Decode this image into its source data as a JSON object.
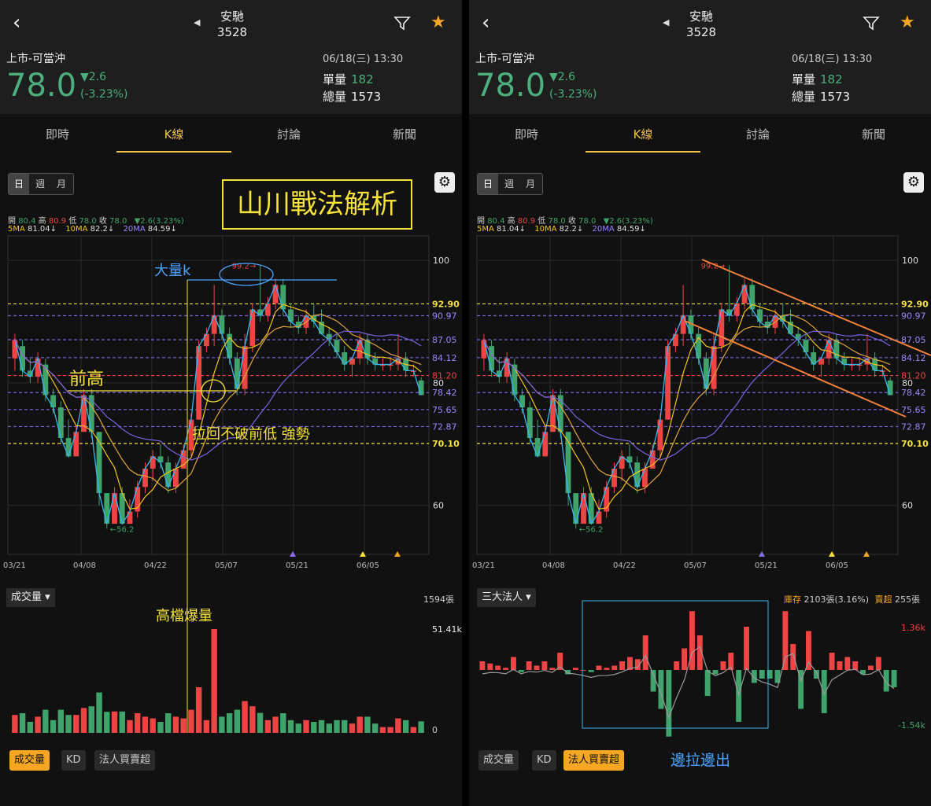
{
  "header": {
    "stock_name": "安馳",
    "stock_code": "3528",
    "market": "上市-可當沖",
    "datetime": "06/18(三) 13:30",
    "price": "78.0",
    "change": "▼2.6",
    "change_pct": "(-3.23%)",
    "vol_label": "單量",
    "vol_value": "182",
    "total_label": "總量",
    "total_value": "1573",
    "back_icon": "chevron-left-icon",
    "prev_icon": "triangle-left-icon",
    "filter_icon": "filter-icon",
    "star_icon": "star-icon"
  },
  "tabs": [
    "即時",
    "K線",
    "討論",
    "新聞"
  ],
  "active_tab": "K線",
  "periods": [
    "日",
    "週",
    "月"
  ],
  "active_period": "日",
  "ohlc_line": {
    "open_label": "開",
    "open": "80.4",
    "high_label": "高",
    "high": "80.9",
    "low_label": "低",
    "low": "78.0",
    "close_label": "收",
    "close": "78.0",
    "change": "▼2.6(3.23%)"
  },
  "ma_line": {
    "ma5": "5MA",
    "ma5_val": "81.04↓",
    "ma10": "10MA",
    "ma10_val": "82.2↓",
    "ma20": "20MA",
    "ma20_val": "84.59↓"
  },
  "colors": {
    "up": "#ef4444",
    "down": "#3fa36b",
    "ma5": "#f5c518",
    "ma10": "#e0a43a",
    "ma20": "#7b63e0",
    "accent": "#f0c24b",
    "annotation": "#f5e23b",
    "price_green": "#4caf7d"
  },
  "price_axis": {
    "ticks": [
      "100",
      "80",
      "60"
    ],
    "lines": [
      "92.90",
      "90.97",
      "87.05",
      "84.12",
      "81.20",
      "78.42",
      "75.65",
      "72.87",
      "70.10"
    ],
    "right_labels_p1": [
      "92.90",
      "90.97",
      "87.05",
      "84.12",
      "81.20",
      "78.42",
      "75.65",
      "72.87",
      "70.10"
    ]
  },
  "chart_marks": {
    "high": "99.2→",
    "low": "←56.2"
  },
  "x_labels": [
    "03/21",
    "04/08",
    "04/22",
    "05/07",
    "05/21",
    "06/05"
  ],
  "chart_data": {
    "type": "candlestick",
    "ylim": [
      52,
      104
    ],
    "candles": [
      {
        "o": 84,
        "h": 88,
        "l": 82,
        "c": 87
      },
      {
        "o": 86,
        "h": 87,
        "l": 81,
        "c": 82
      },
      {
        "o": 82,
        "h": 84,
        "l": 80,
        "c": 81
      },
      {
        "o": 81,
        "h": 85,
        "l": 80,
        "c": 84
      },
      {
        "o": 83,
        "h": 84,
        "l": 77,
        "c": 78
      },
      {
        "o": 78,
        "h": 79,
        "l": 75,
        "c": 76
      },
      {
        "o": 76,
        "h": 77,
        "l": 70,
        "c": 71
      },
      {
        "o": 71,
        "h": 74,
        "l": 68,
        "c": 68
      },
      {
        "o": 68,
        "h": 73,
        "l": 68,
        "c": 72
      },
      {
        "o": 72,
        "h": 79,
        "l": 72,
        "c": 78
      },
      {
        "o": 78,
        "h": 79,
        "l": 71,
        "c": 72
      },
      {
        "o": 72,
        "h": 72,
        "l": 60,
        "c": 62
      },
      {
        "o": 62,
        "h": 62,
        "l": 56.2,
        "c": 57
      },
      {
        "o": 57,
        "h": 63,
        "l": 57,
        "c": 62
      },
      {
        "o": 62,
        "h": 63,
        "l": 57,
        "c": 57
      },
      {
        "o": 57,
        "h": 61,
        "l": 57,
        "c": 59
      },
      {
        "o": 59,
        "h": 64,
        "l": 58,
        "c": 63
      },
      {
        "o": 63,
        "h": 67,
        "l": 62,
        "c": 66
      },
      {
        "o": 66,
        "h": 69,
        "l": 64,
        "c": 68
      },
      {
        "o": 68,
        "h": 70,
        "l": 66,
        "c": 67
      },
      {
        "o": 67,
        "h": 68,
        "l": 62,
        "c": 63
      },
      {
        "o": 63,
        "h": 67,
        "l": 62,
        "c": 66
      },
      {
        "o": 66,
        "h": 70,
        "l": 66,
        "c": 69
      },
      {
        "o": 69,
        "h": 75,
        "l": 68,
        "c": 74
      },
      {
        "o": 74,
        "h": 87,
        "l": 74,
        "c": 86
      },
      {
        "o": 86,
        "h": 89,
        "l": 85,
        "c": 88
      },
      {
        "o": 88,
        "h": 96,
        "l": 86,
        "c": 91
      },
      {
        "o": 91,
        "h": 92,
        "l": 87,
        "c": 88
      },
      {
        "o": 88,
        "h": 89,
        "l": 83,
        "c": 84
      },
      {
        "o": 84,
        "h": 85,
        "l": 78,
        "c": 79
      },
      {
        "o": 79,
        "h": 88,
        "l": 78,
        "c": 86
      },
      {
        "o": 86,
        "h": 93,
        "l": 85,
        "c": 92
      },
      {
        "o": 92,
        "h": 99.2,
        "l": 90,
        "c": 91
      },
      {
        "o": 91,
        "h": 94,
        "l": 90,
        "c": 93
      },
      {
        "o": 93,
        "h": 97,
        "l": 92,
        "c": 96
      },
      {
        "o": 96,
        "h": 97,
        "l": 91,
        "c": 92
      },
      {
        "o": 92,
        "h": 93,
        "l": 89,
        "c": 90
      },
      {
        "o": 90,
        "h": 91,
        "l": 88,
        "c": 89
      },
      {
        "o": 89,
        "h": 92,
        "l": 88,
        "c": 91
      },
      {
        "o": 91,
        "h": 93,
        "l": 89,
        "c": 90
      },
      {
        "o": 90,
        "h": 92,
        "l": 88,
        "c": 88
      },
      {
        "o": 88,
        "h": 89,
        "l": 86,
        "c": 87
      },
      {
        "o": 87,
        "h": 88,
        "l": 84,
        "c": 85
      },
      {
        "o": 85,
        "h": 86,
        "l": 82,
        "c": 83
      },
      {
        "o": 83,
        "h": 84,
        "l": 81,
        "c": 84
      },
      {
        "o": 84,
        "h": 88,
        "l": 83,
        "c": 87
      },
      {
        "o": 87,
        "h": 88,
        "l": 83,
        "c": 84
      },
      {
        "o": 84,
        "h": 85,
        "l": 82,
        "c": 83
      },
      {
        "o": 83,
        "h": 84,
        "l": 82,
        "c": 83
      },
      {
        "o": 83,
        "h": 84,
        "l": 82,
        "c": 83
      },
      {
        "o": 83,
        "h": 88,
        "l": 82,
        "c": 84
      },
      {
        "o": 84,
        "h": 85,
        "l": 81,
        "c": 82
      },
      {
        "o": 82,
        "h": 83,
        "l": 81,
        "c": 82
      },
      {
        "o": 80.4,
        "h": 80.9,
        "l": 78,
        "c": 78
      }
    ],
    "volume": {
      "max_label": "51.41k",
      "min_label": "0",
      "total_label": "1594張"
    }
  },
  "left_annotations": {
    "title": "山川戰法解析",
    "big_k": "大量k",
    "prev_high": "前高",
    "pullback": "拉回不破前低 強勢",
    "high_volume": "高檔爆量"
  },
  "right_annotations": {
    "in_out": "邊拉邊出"
  },
  "bottom_left": {
    "dropdown": "成交量",
    "dropdown_icon": "caret-down-icon",
    "buttons": [
      "成交量",
      "KD",
      "法人買賣超"
    ],
    "active": "成交量"
  },
  "bottom_right": {
    "dropdown": "三大法人",
    "inventory_label": "庫存",
    "inventory_value": "2103張(3.16%)",
    "net_label": "賣超",
    "net_value": "255張",
    "max_label": "1.36k",
    "min_label": "-1.54k",
    "buttons": [
      "成交量",
      "KD",
      "法人買賣超"
    ],
    "active": "法人買賣超"
  },
  "institutional": [
    {
      "v": 0.2
    },
    {
      "v": 0.15
    },
    {
      "v": 0.1
    },
    {
      "v": 0.05
    },
    {
      "v": 0.3
    },
    {
      "v": -0.05
    },
    {
      "v": 0.2
    },
    {
      "v": 0.1
    },
    {
      "v": 0.2
    },
    {
      "v": 0.05
    },
    {
      "v": 0.4
    },
    {
      "v": -0.1
    },
    {
      "v": 0.05
    },
    {
      "v": 0.0
    },
    {
      "v": -0.05
    },
    {
      "v": 0.1
    },
    {
      "v": 0.05
    },
    {
      "v": 0.1
    },
    {
      "v": 0.2
    },
    {
      "v": 0.3
    },
    {
      "v": 0.25
    },
    {
      "v": 0.8
    },
    {
      "v": -0.5
    },
    {
      "v": -0.9
    },
    {
      "v": -1.54
    },
    {
      "v": 0.2
    },
    {
      "v": 0.5
    },
    {
      "v": 1.36
    },
    {
      "v": 0.8
    },
    {
      "v": -0.6
    },
    {
      "v": -0.1
    },
    {
      "v": 0.2
    },
    {
      "v": 0.4
    },
    {
      "v": -1.2
    },
    {
      "v": 1.0
    },
    {
      "v": -0.3
    },
    {
      "v": -0.2
    },
    {
      "v": -0.2
    },
    {
      "v": -0.3
    },
    {
      "v": 1.36
    },
    {
      "v": 0.6
    },
    {
      "v": -0.9
    },
    {
      "v": 0.9
    },
    {
      "v": -0.2
    },
    {
      "v": -1.0
    },
    {
      "v": 0.4
    },
    {
      "v": 0.2
    },
    {
      "v": 0.3
    },
    {
      "v": 0.2
    },
    {
      "v": -0.1
    },
    {
      "v": 0.1
    },
    {
      "v": 0.3
    },
    {
      "v": -0.5
    },
    {
      "v": -0.4
    }
  ]
}
